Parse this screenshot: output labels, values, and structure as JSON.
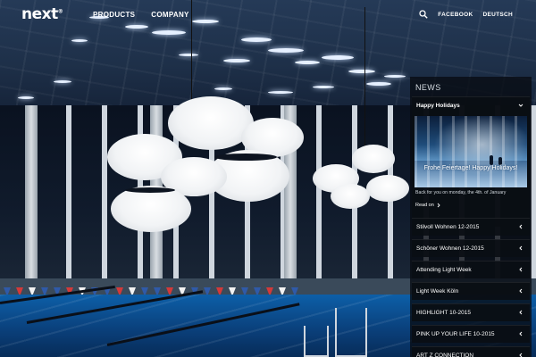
{
  "header": {
    "logo": "next",
    "logo_mark": "®",
    "nav": [
      "PRODUCTS",
      "COMPANY"
    ],
    "right_links": [
      "FACEBOOK",
      "DEUTSCH"
    ]
  },
  "news": {
    "title": "NEWS",
    "featured": {
      "title": "Happy Holidays",
      "image_caption": "Frohe Feiertage!  Happy Holidays!",
      "text": "Back for you on monday, the 4th. of January",
      "read_on": "Read on"
    },
    "items": [
      "Stilvoll Wohnen 12-2015",
      "Schöner Wohnen 12-2015",
      "Attending Light Week",
      "Light Week Köln",
      "HIGHLIGHT 10-2015",
      "PINK UP YOUR LIFE 10-2015",
      "ART Z CONNECTION"
    ]
  },
  "colors": {
    "sidebar_bg": "#0a0e14",
    "pool": "#0d5fa8",
    "text": "#ffffff"
  }
}
